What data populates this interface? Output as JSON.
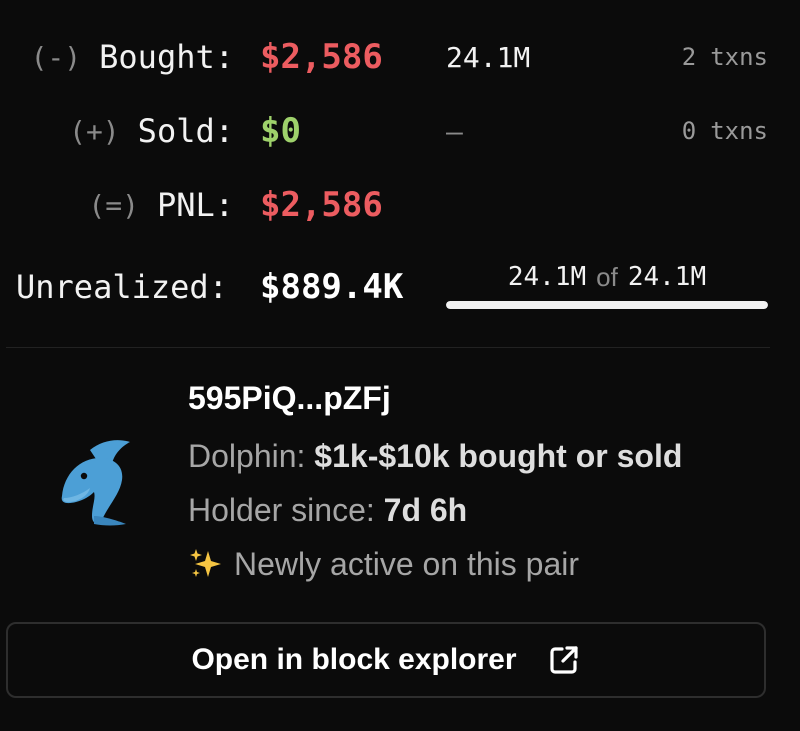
{
  "stats": {
    "bought": {
      "sign": "(-)",
      "label": "Bought:",
      "amount": "$2,586",
      "tokens": "24.1M",
      "txns_count": "2",
      "txns_unit": "txns",
      "amount_color": "#ec5c60"
    },
    "sold": {
      "sign": "(+)",
      "label": "Sold:",
      "amount": "$0",
      "tokens": "—",
      "txns_count": "0",
      "txns_unit": "txns",
      "amount_color": "#9ed16b"
    },
    "pnl": {
      "sign": "(=)",
      "label": "PNL:",
      "amount": "$2,586",
      "amount_color": "#ec5c60"
    },
    "unrealized": {
      "label": "Unrealized:",
      "amount": "$889.4K",
      "held": "24.1M",
      "of_text": "of",
      "total": "24.1M",
      "held_fraction": 1.0
    }
  },
  "wallet": {
    "address": "595PiQ...pZFj",
    "avatar_icon": "dolphin-icon",
    "tier": {
      "prefix": "Dolphin:",
      "value": "$1k-$10k bought or sold"
    },
    "holder_since": {
      "prefix": "Holder since:",
      "value": "7d 6h"
    },
    "activity": {
      "icon": "sparkles-icon",
      "text": "Newly active on this pair"
    }
  },
  "actions": {
    "explorer_label": "Open in block explorer",
    "explorer_icon": "external-link-icon"
  },
  "colors": {
    "background": "#0b0b0b",
    "loss_red": "#ec5c60",
    "gain_green": "#9ed16b",
    "dolphin_blue": "#4c9fd6"
  }
}
